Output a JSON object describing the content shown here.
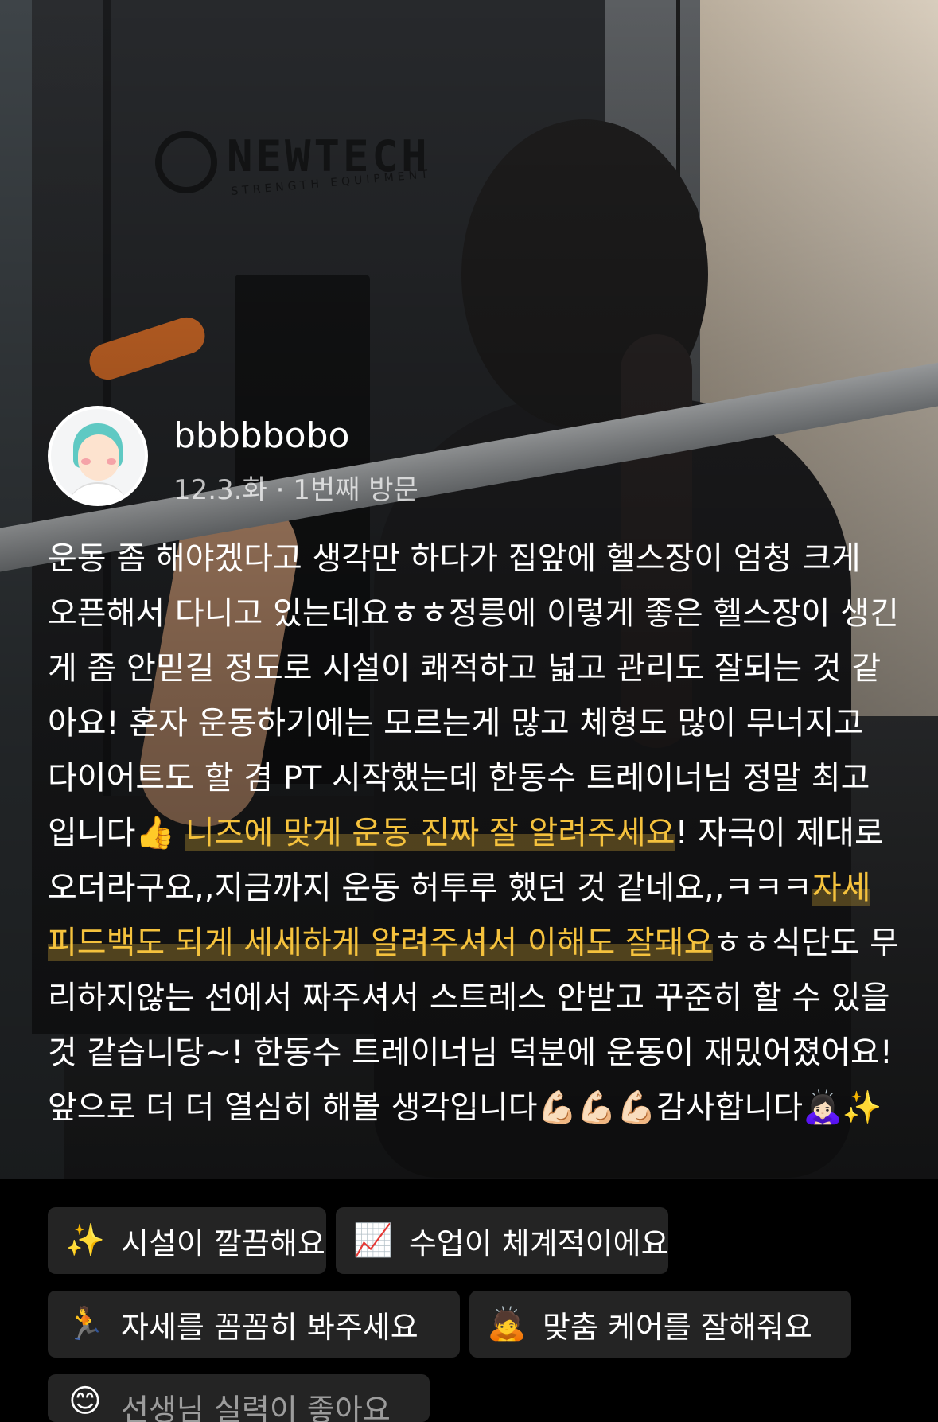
{
  "profile": {
    "username": "bbbbbobo",
    "visit_meta": "12.3.화 · 1번째 방문"
  },
  "review": {
    "segments": [
      {
        "text": "운동 좀 해야겠다고 생각만 하다가 집앞에 헬스장이 엄청 크게 오픈해서 다니고 있는데요ㅎㅎ정릉에 이렇게 좋은 헬스장이 생긴게 좀 안믿길 정도로 시설이 쾌적하고 넓고 관리도 잘되는 것 같아요! 혼자 운동하기에는 모르는게 많고 체형도 많이 무너지고 다이어트도 할 겸 PT 시작했는데 한동수 트레이너님 정말 최고입니다👍 ",
        "highlight": false
      },
      {
        "text": "니즈에 맞게 운동 진짜 잘 알려주세요",
        "highlight": true
      },
      {
        "text": "! 자극이 제대로 오더라구요,,지금까지 운동 허투루 했던 것 같네요,,ㅋㅋㅋ",
        "highlight": false
      },
      {
        "text": "자세 피드백도 되게 세세하게 알려주셔서 이해도 잘돼요",
        "highlight": true
      },
      {
        "text": "ㅎㅎ식단도 무리하지않는 선에서 짜주셔서 스트레스 안받고 꾸준히 할 수 있을 것 같습니당~! 한동수 트레이너님 덕분에 운동이 재밌어졌어요! 앞으로 더 더 열심히 해볼 생각입니다💪🏻💪🏻💪🏻감사합니다🙇🏻‍♀️✨",
        "highlight": false
      }
    ]
  },
  "tags": [
    {
      "icon": "sparkles-icon",
      "emoji": "✨",
      "label": "시설이 깔끔해요"
    },
    {
      "icon": "chart-increasing-icon",
      "emoji": "📈",
      "label": "수업이 체계적이에요"
    },
    {
      "icon": "person-lunging-icon",
      "emoji": "🏃",
      "label": "자세를 꼼꼼히 봐주세요"
    },
    {
      "icon": "person-bowing-icon",
      "emoji": "🙇",
      "label": "맞춤 케어를 잘해줘요"
    },
    {
      "icon": "smiling-face-icon",
      "emoji": "😊",
      "label": "선생님 실력이 좋아요"
    }
  ],
  "colors": {
    "highlight": "#f5c23d",
    "chip_background": "#242424",
    "page_background": "#000000"
  }
}
